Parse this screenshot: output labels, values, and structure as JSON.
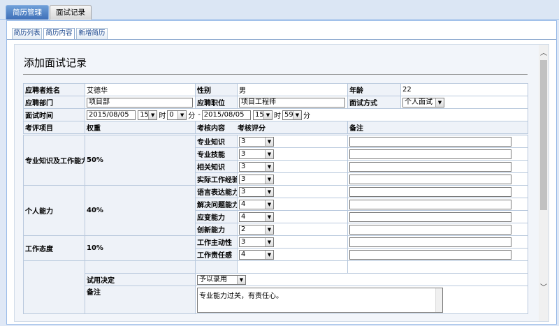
{
  "top_tabs": [
    {
      "label": "简历管理",
      "active": true
    },
    {
      "label": "面试记录",
      "active": false
    }
  ],
  "sub_tabs": [
    {
      "label": "简历列表",
      "active": false
    },
    {
      "label": "简历内容",
      "active": true
    },
    {
      "label": "新增简历",
      "active": false
    }
  ],
  "page": {
    "title": "添加面试记录"
  },
  "basic": {
    "name_label": "应聘者姓名",
    "name_value": "艾德华",
    "gender_label": "性别",
    "gender_value": "男",
    "age_label": "年龄",
    "age_value": "22",
    "dept_label": "应聘部门",
    "dept_value": "项目部",
    "position_label": "应聘职位",
    "position_value": "项目工程师",
    "method_label": "面试方式",
    "method_value": "个人面试"
  },
  "time": {
    "label": "面试时间",
    "start_date": "2015/08/05",
    "start_hour": "15",
    "hour_unit": "时",
    "start_min": "0",
    "min_unit": "分",
    "separator": "-",
    "end_date": "2015/08/05",
    "end_hour": "15",
    "end_min": "59"
  },
  "headers": {
    "item": "考评项目",
    "weight": "权重",
    "content": "考核内容",
    "score": "考核评分",
    "remark": "备注"
  },
  "groups": [
    {
      "name": "专业知识及工作能力",
      "weight": "50%",
      "items": [
        {
          "content": "专业知识",
          "score": "3"
        },
        {
          "content": "专业技能",
          "score": "3"
        },
        {
          "content": "相关知识",
          "score": "3"
        },
        {
          "content": "实际工作经验",
          "score": "3"
        }
      ]
    },
    {
      "name": "个人能力",
      "weight": "40%",
      "items": [
        {
          "content": "语言表达能力",
          "score": "3"
        },
        {
          "content": "解决问题能力",
          "score": "4"
        },
        {
          "content": "应变能力",
          "score": "4"
        },
        {
          "content": "创新能力",
          "score": "2"
        }
      ]
    },
    {
      "name": "工作态度",
      "weight": "10%",
      "items": [
        {
          "content": "工作主动性",
          "score": "3"
        },
        {
          "content": "工作责任感",
          "score": "4"
        }
      ]
    }
  ],
  "decision": {
    "label": "试用决定",
    "value": "予以录用"
  },
  "final_remark": {
    "label": "备注",
    "value": "专业能力过关，有责任心。"
  },
  "colors": {
    "active_tab": "#3e6fb8",
    "panel_border": "#99bbe8"
  }
}
